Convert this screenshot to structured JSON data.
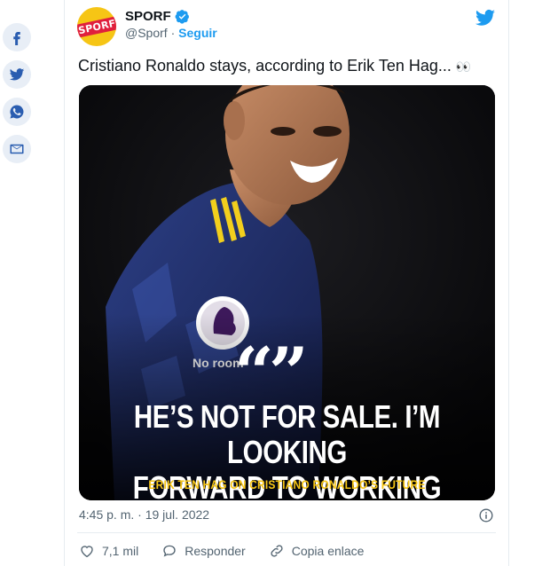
{
  "share": {
    "items": [
      {
        "icon": "facebook-icon"
      },
      {
        "icon": "twitter-icon"
      },
      {
        "icon": "whatsapp-icon"
      },
      {
        "icon": "email-icon"
      }
    ]
  },
  "tweet": {
    "author": {
      "avatar_text": "SPORF",
      "name": "SPORF",
      "handle": "@Sporf",
      "separator": " · ",
      "follow_label": "Seguir"
    },
    "text": "Cristiano Ronaldo stays, according to Erik Ten Hag...",
    "text_emoji": "👀",
    "media": {
      "quote_marks": "“”",
      "headline_line1": "HE’S NOT FOR SALE. I’M LOOKING",
      "headline_line2": "FORWARD TO WORKING WITH HIM",
      "caption": "ERIK TEN HAG ON CRISTIANO RONALDO’S FUTURE",
      "sponsor_text": "No room"
    },
    "timestamp": "4:45 p. m. · 19 jul. 2022",
    "actions": {
      "likes": "7,1 mil",
      "reply_label": "Responder",
      "copy_link_label": "Copia enlace"
    }
  },
  "colors": {
    "accent": "#1d9bf0",
    "avatar_bg": "#f6c515",
    "caption_yellow": "#f6c515",
    "share_bg": "#e8eef6",
    "share_icon": "#2a5db0"
  }
}
